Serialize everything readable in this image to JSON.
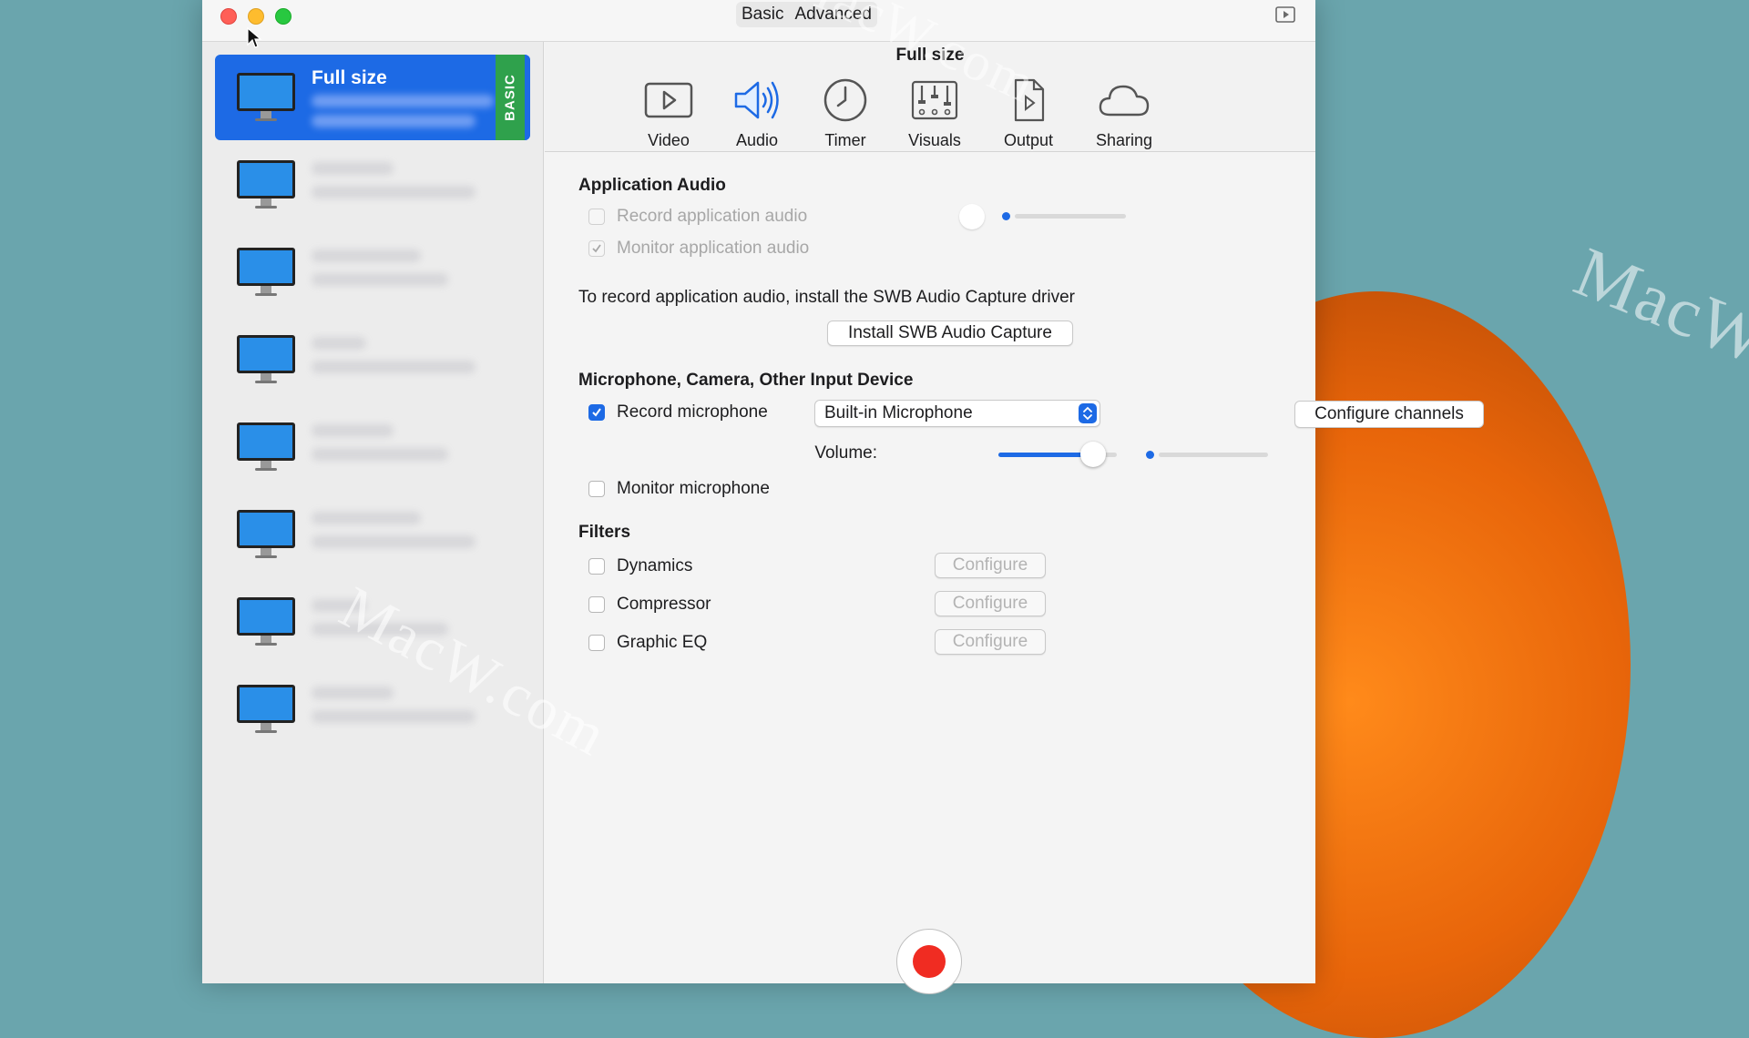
{
  "window": {
    "mode_tabs": [
      "Basic",
      "Advanced"
    ]
  },
  "sidebar": {
    "presets": [
      {
        "name": "Full size",
        "selected": true,
        "tag": "BASIC"
      },
      {
        "name": "",
        "selected": false
      },
      {
        "name": "",
        "selected": false
      },
      {
        "name": "",
        "selected": false
      },
      {
        "name": "",
        "selected": false
      },
      {
        "name": "",
        "selected": false
      },
      {
        "name": "",
        "selected": false
      },
      {
        "name": "",
        "selected": false
      }
    ]
  },
  "toolbar": {
    "title": "Full size",
    "tabs": [
      {
        "label": "Video",
        "icon": "video-icon"
      },
      {
        "label": "Audio",
        "icon": "speaker-icon",
        "active": true
      },
      {
        "label": "Timer",
        "icon": "clock-icon"
      },
      {
        "label": "Visuals",
        "icon": "visuals-icon"
      },
      {
        "label": "Output",
        "icon": "document-icon"
      },
      {
        "label": "Sharing",
        "icon": "cloud-icon"
      }
    ]
  },
  "app_audio": {
    "heading": "Application Audio",
    "record_label": "Record application audio",
    "record_checked": false,
    "monitor_label": "Monitor application audio",
    "monitor_checked": true,
    "install_note": "To record application audio, install the SWB Audio Capture driver",
    "install_button": "Install SWB Audio Capture"
  },
  "mic": {
    "heading": "Microphone, Camera, Other Input Device",
    "record_label": "Record microphone",
    "record_checked": true,
    "device_selected": "Built-in Microphone",
    "configure_channels": "Configure channels",
    "volume_label": "Volume:",
    "volume_level": 0.8,
    "monitor_label": "Monitor microphone",
    "monitor_checked": false
  },
  "filters": {
    "heading": "Filters",
    "items": [
      {
        "label": "Dynamics",
        "checked": false,
        "button": "Configure"
      },
      {
        "label": "Compressor",
        "checked": false,
        "button": "Configure"
      },
      {
        "label": "Graphic EQ",
        "checked": false,
        "button": "Configure"
      }
    ]
  },
  "watermark": "MacW.com",
  "colors": {
    "accent": "#1d6ae5",
    "basic_tag": "#2fa14c",
    "record": "#f02c22",
    "desktop": "#6aa5ad"
  }
}
